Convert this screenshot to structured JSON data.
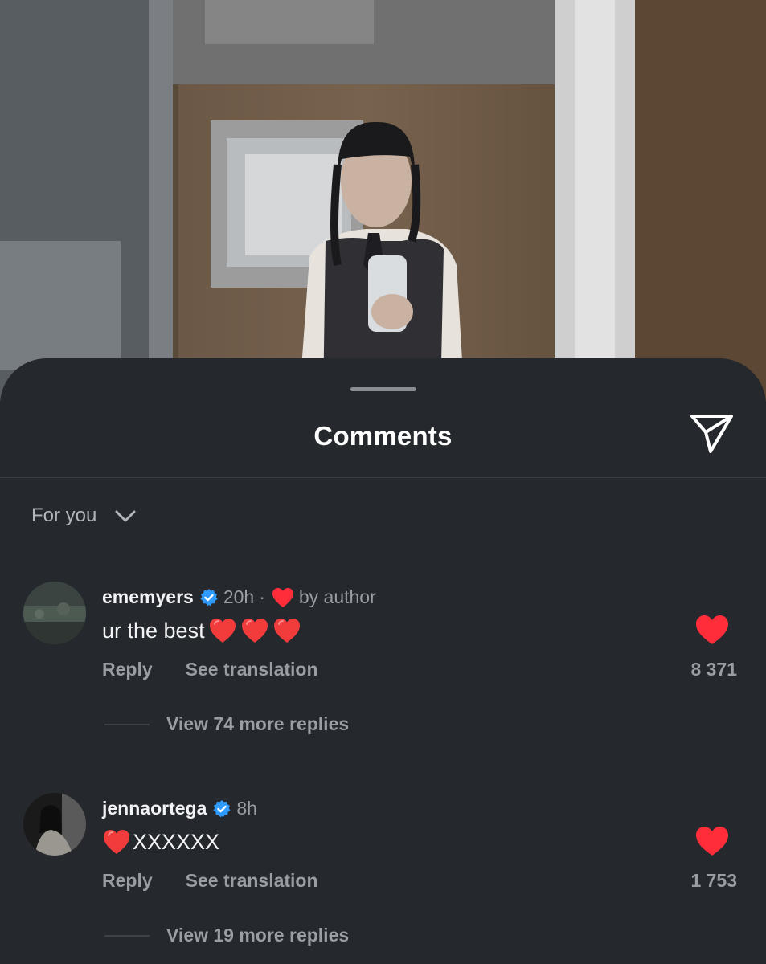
{
  "sheet": {
    "title": "Comments",
    "share_icon": "paper-plane-icon",
    "sort_label": "For you",
    "sort_icon": "chevron-down-icon"
  },
  "colors": {
    "sheet_bg": "#25282d",
    "like_red": "#ff2d3a",
    "verified_blue": "#2f9bff",
    "secondary_text": "#9a9da3"
  },
  "comments": [
    {
      "username": "ememyers",
      "verified": true,
      "time": "20h",
      "separator": "·",
      "liked_by_author_label": "by author",
      "text": "ur the best",
      "text_emojis": [
        "red-heart",
        "red-heart",
        "red-heart"
      ],
      "reply_label": "Reply",
      "translate_label": "See translation",
      "liked": true,
      "like_count": "8 371",
      "replies_label": "View 74 more replies"
    },
    {
      "username": "jennaortega",
      "verified": true,
      "time": "8h",
      "text": "XXXXXX",
      "text_emojis": [
        "red-heart"
      ],
      "reply_label": "Reply",
      "translate_label": "See translation",
      "liked": true,
      "like_count": "1 753",
      "replies_label": "View 19 more replies"
    }
  ]
}
